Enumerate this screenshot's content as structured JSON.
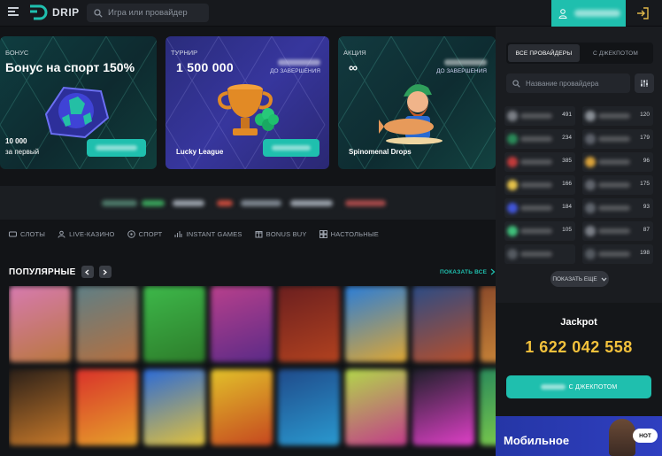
{
  "header": {
    "logo_text": "DRIP",
    "search_placeholder": "Игра или провайдер"
  },
  "banners": [
    {
      "kind": "БОНУС",
      "title": "Бонус на спорт 150%",
      "amount": "10 000",
      "sub": "за первый"
    },
    {
      "kind": "ТУРНИР",
      "value": "1 500 000",
      "until": "ДО ЗАВЕРШЕНИЯ",
      "name": "Lucky League"
    },
    {
      "kind": "АКЦИЯ",
      "value": "∞",
      "until": "ДО ЗАВЕРШЕНИЯ",
      "name": "Spinomenal Drops"
    }
  ],
  "categories": [
    {
      "label": "СЛОТЫ",
      "icon": "slots-icon"
    },
    {
      "label": "LIVE-КАЗИНО",
      "icon": "live-casino-icon"
    },
    {
      "label": "СПОРТ",
      "icon": "sport-icon"
    },
    {
      "label": "INSTANT GAMES",
      "icon": "instant-games-icon"
    },
    {
      "label": "BONUS BUY",
      "icon": "bonus-buy-icon"
    },
    {
      "label": "НАСТОЛЬНЫЕ",
      "icon": "table-games-icon"
    }
  ],
  "popular": {
    "title": "ПОПУЛЯРНЫЕ",
    "show_all": "ПОКАЗАТЬ ВСЕ"
  },
  "sidebar": {
    "tab_all": "ВСЕ ПРОВАЙДЕРЫ",
    "tab_jackpot": "С ДЖЕКПОТОМ",
    "provider_search_placeholder": "Название провайдера",
    "providers": [
      {
        "count": "491",
        "color": "#7b7f86"
      },
      {
        "count": "120",
        "color": "#8a8f96"
      },
      {
        "count": "234",
        "color": "#2a8a58"
      },
      {
        "count": "179",
        "color": "#5d616a"
      },
      {
        "count": "385",
        "color": "#c13b3b"
      },
      {
        "count": "96",
        "color": "#d9a23a"
      },
      {
        "count": "166",
        "color": "#e4c14a"
      },
      {
        "count": "175",
        "color": "#61656d"
      },
      {
        "count": "184",
        "color": "#4155d8"
      },
      {
        "count": "93",
        "color": "#5f646c"
      },
      {
        "count": "105",
        "color": "#3fbf7a"
      },
      {
        "count": "87",
        "color": "#7a7e86"
      },
      {
        "count": "",
        "color": "#555a61"
      },
      {
        "count": "198",
        "color": "#555a61"
      }
    ],
    "show_more": "ПОКАЗАТЬ ЕЩЕ",
    "jackpot_title": "Jackpot",
    "jackpot_amount": "1 622 042 558",
    "jackpot_button": "С ДЖЕКПОТОМ",
    "mobile_title": "Мобильное",
    "hot_badge": "HOT"
  },
  "colors": {
    "accent": "#1fbfae",
    "jackpot": "#f2c13c",
    "background": "#121417"
  }
}
